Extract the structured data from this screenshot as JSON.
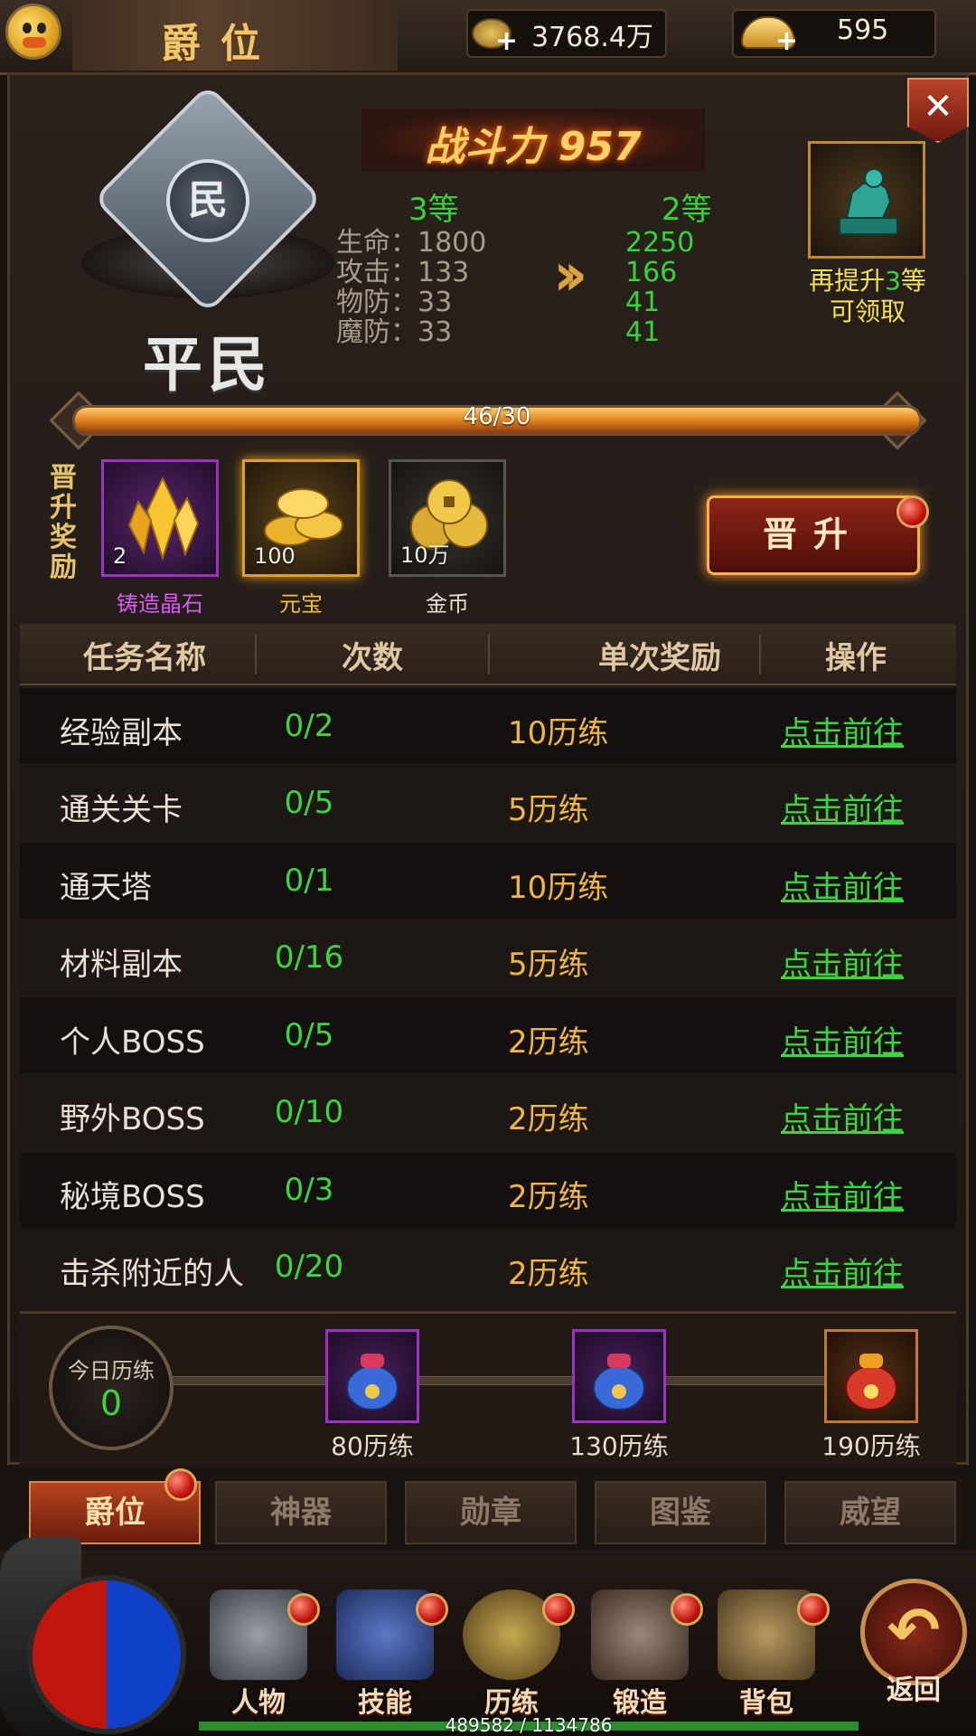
{
  "header": {
    "title": "爵位",
    "copper": "3768.4万",
    "ingots": "595"
  },
  "rank": {
    "emblem_char": "民",
    "name": "平民",
    "combat_power": "战斗力 957"
  },
  "stats": {
    "current_level": "3等",
    "next_level": "2等",
    "rows": [
      {
        "label": "生命：1800",
        "next": "2250"
      },
      {
        "label": "攻击：133",
        "next": "166"
      },
      {
        "label": "物防：33",
        "next": "41"
      },
      {
        "label": "魔防：33",
        "next": "41"
      }
    ]
  },
  "next_reward": {
    "line1_prefix": "再提升",
    "line1_num": "3",
    "line1_suffix": "等",
    "line2": "可领取"
  },
  "progress": {
    "text": "46/30",
    "fraction": 1.0
  },
  "promotion": {
    "label": "晋升奖励",
    "items": [
      {
        "name": "铸造晶石",
        "count": "2",
        "name_color": "#d55cf0"
      },
      {
        "name": "元宝",
        "count": "100",
        "name_color": "#f1c13c"
      },
      {
        "name": "金币",
        "count": "10万",
        "name_color": "#e8e2d8"
      }
    ],
    "button": "晋升"
  },
  "table": {
    "headers": [
      "任务名称",
      "次数",
      "单次奖励",
      "操作"
    ],
    "rows": [
      {
        "name": "经验副本",
        "count": "0/2",
        "reward": "10历练",
        "action": "点击前往"
      },
      {
        "name": "通关关卡",
        "count": "0/5",
        "reward": "5历练",
        "action": "点击前往"
      },
      {
        "name": "通天塔",
        "count": "0/1",
        "reward": "10历练",
        "action": "点击前往"
      },
      {
        "name": "材料副本",
        "count": "0/16",
        "reward": "5历练",
        "action": "点击前往"
      },
      {
        "name": "个人BOSS",
        "count": "0/5",
        "reward": "2历练",
        "action": "点击前往"
      },
      {
        "name": "野外BOSS",
        "count": "0/10",
        "reward": "2历练",
        "action": "点击前往"
      },
      {
        "name": "秘境BOSS",
        "count": "0/3",
        "reward": "2历练",
        "action": "点击前往"
      },
      {
        "name": "击杀附近的人",
        "count": "0/20",
        "reward": "2历练",
        "action": "点击前往"
      }
    ]
  },
  "daily": {
    "label": "今日历练",
    "value": "0",
    "milestones": [
      "80历练",
      "130历练",
      "190历练"
    ]
  },
  "tabs": [
    "爵位",
    "神器",
    "勋章",
    "图鉴",
    "威望"
  ],
  "nav": [
    "人物",
    "技能",
    "历练",
    "锻造",
    "背包"
  ],
  "back_label": "返回",
  "exp_text": "489582 / 1134786"
}
